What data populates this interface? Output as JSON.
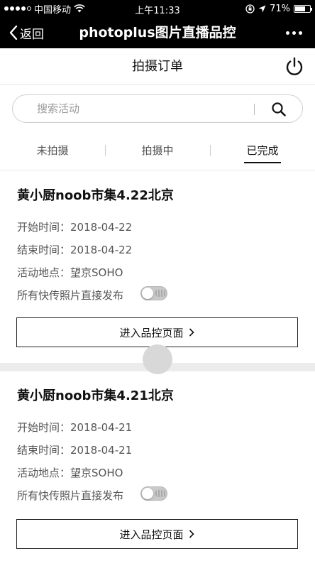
{
  "status_bar": {
    "carrier": "中国移动",
    "time": "上午11:33",
    "battery_percent": "71%",
    "battery_level": 0.71,
    "signal_dots_filled": 4,
    "signal_dots_total": 5
  },
  "nav": {
    "back_label": "返回",
    "title": "photoplus图片直播品控"
  },
  "page": {
    "title": "拍摄订单"
  },
  "search": {
    "placeholder": "搜索活动",
    "value": ""
  },
  "tabs": [
    {
      "label": "未拍摄",
      "active": false
    },
    {
      "label": "拍摄中",
      "active": false
    },
    {
      "label": "已完成",
      "active": true
    }
  ],
  "orders": [
    {
      "title": "黄小厨noob市集4.22北京",
      "start_label": "开始时间：",
      "start": "2018-04-22",
      "end_label": "结束时间：",
      "end": "2018-04-22",
      "location_label": "活动地点：",
      "location": "望京SOHO",
      "publish_label": "所有快传照片直接发布",
      "publish_enabled": false,
      "button_label": "进入品控页面"
    },
    {
      "title": "黄小厨noob市集4.21北京",
      "start_label": "开始时间：",
      "start": "2018-04-21",
      "end_label": "结束时间：",
      "end": "2018-04-21",
      "location_label": "活动地点：",
      "location": "望京SOHO",
      "publish_label": "所有快传照片直接发布",
      "publish_enabled": false,
      "button_label": "进入品控页面"
    }
  ],
  "colors": {
    "bar_background": "#000000",
    "separator": "#ececec",
    "toggle_off": "#c9c9c9"
  }
}
